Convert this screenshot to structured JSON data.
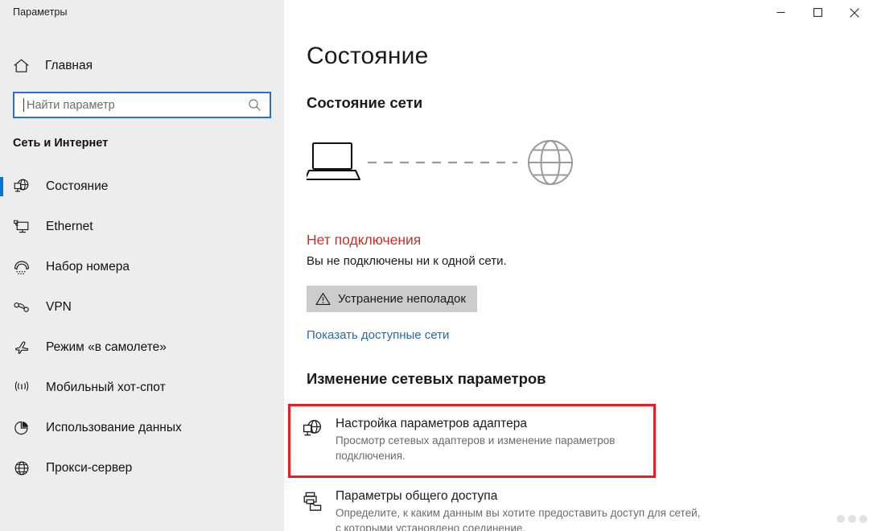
{
  "window": {
    "caption": "Параметры",
    "minimize_label": "Свернуть",
    "maximize_label": "Развернуть",
    "close_label": "Закрыть"
  },
  "sidebar": {
    "home_label": "Главная",
    "search": {
      "placeholder": "Найти параметр",
      "value": ""
    },
    "group_title": "Сеть и Интернет",
    "items": [
      {
        "label": "Состояние",
        "icon": "globe-monitor-icon",
        "selected": true
      },
      {
        "label": "Ethernet",
        "icon": "monitor-network-icon",
        "selected": false
      },
      {
        "label": "Набор номера",
        "icon": "dial-up-phone-icon",
        "selected": false
      },
      {
        "label": "VPN",
        "icon": "vpn-key-icon",
        "selected": false
      },
      {
        "label": "Режим «в самолете»",
        "icon": "airplane-icon",
        "selected": false
      },
      {
        "label": "Мобильный хот-спот",
        "icon": "hotspot-icon",
        "selected": false
      },
      {
        "label": "Использование данных",
        "icon": "pie-chart-icon",
        "selected": false
      },
      {
        "label": "Прокси-сервер",
        "icon": "globe-icon",
        "selected": false
      }
    ]
  },
  "main": {
    "page_title": "Состояние",
    "network_status_heading": "Состояние сети",
    "diagram": {
      "device_icon": "laptop-icon",
      "link_icon": "dashed-line",
      "internet_icon": "globe-icon"
    },
    "connection": {
      "status": "Нет подключения",
      "status_color": "#d42d20",
      "description": "Вы не подключены ни к одной сети."
    },
    "troubleshoot_button": {
      "label": "Устранение неполадок",
      "icon": "warning-triangle-icon"
    },
    "show_networks_link": "Показать доступные сети",
    "change_settings_heading": "Изменение сетевых параметров",
    "settings": [
      {
        "title": "Настройка параметров адаптера",
        "description": "Просмотр сетевых адаптеров и изменение параметров подключения.",
        "icon": "globe-monitor-icon",
        "highlighted": true,
        "highlight_color": "#ed1c24"
      },
      {
        "title": "Параметры общего доступа",
        "description": "Определите, к каким данным вы хотите предоставить доступ для сетей, с которыми установлено соединение.",
        "icon": "printer-folder-share-icon",
        "highlighted": false
      }
    ],
    "page_indicator_dots": 3
  }
}
